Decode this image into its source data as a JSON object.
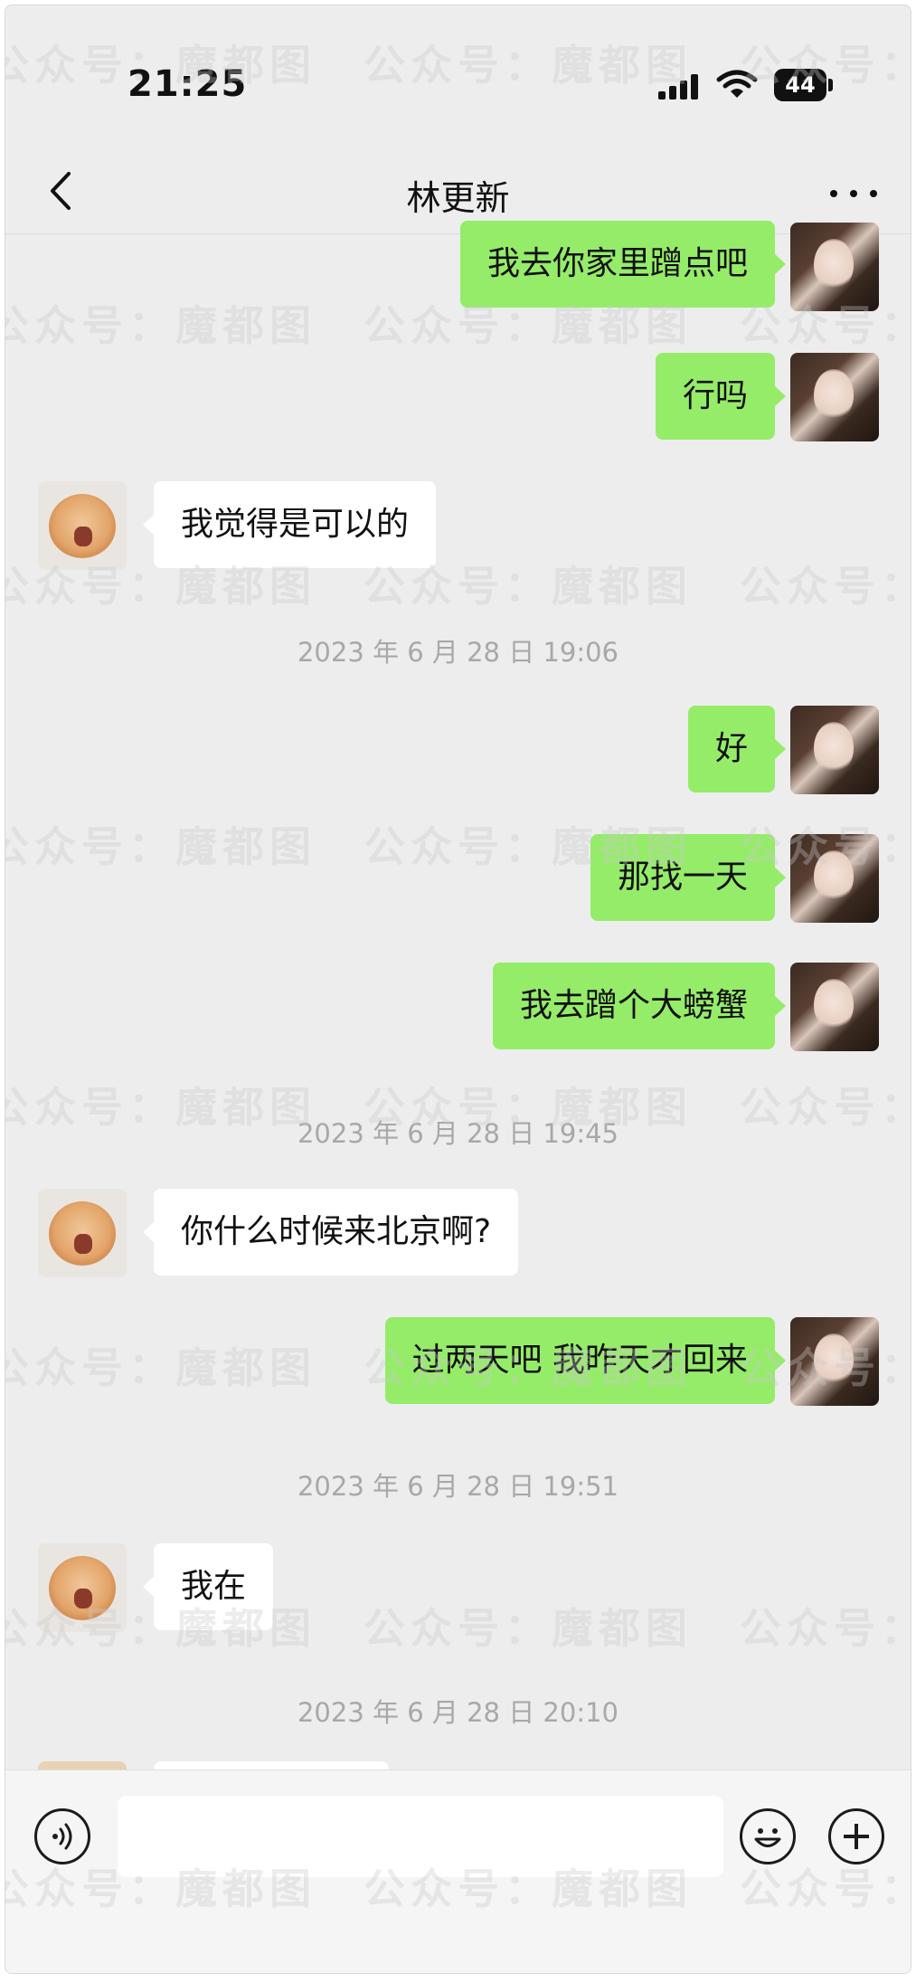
{
  "status_bar": {
    "time": "21:25",
    "battery": "44"
  },
  "header": {
    "title": "林更新"
  },
  "messages": [
    {
      "side": "out",
      "text": "我去你家里蹭点吧"
    },
    {
      "side": "out",
      "text": "行吗"
    },
    {
      "side": "in",
      "text": "我觉得是可以的"
    },
    {
      "side": "out",
      "text": "好"
    },
    {
      "side": "out",
      "text": "那找一天"
    },
    {
      "side": "out",
      "text": "我去蹭个大螃蟹"
    },
    {
      "side": "in",
      "text": "你什么时候来北京啊?"
    },
    {
      "side": "out",
      "text": "过两天吧 我昨天才回来"
    },
    {
      "side": "in",
      "text": "我在"
    }
  ],
  "timestamps": [
    "2023 年 6 月 28 日  19:06",
    "2023 年 6 月 28 日  19:45",
    "2023 年 6 月 28 日  19:51",
    "2023 年 6 月 28 日  20:10"
  ],
  "watermark": "公众号：魔都图",
  "icons": {
    "back": "chevron-left-icon",
    "more": "more-dots-icon",
    "voice": "voice-icon",
    "emoji": "emoji-icon",
    "plus": "plus-icon"
  },
  "colors": {
    "outgoing_bubble": "#95ec69",
    "incoming_bubble": "#ffffff",
    "background": "#ededed"
  }
}
